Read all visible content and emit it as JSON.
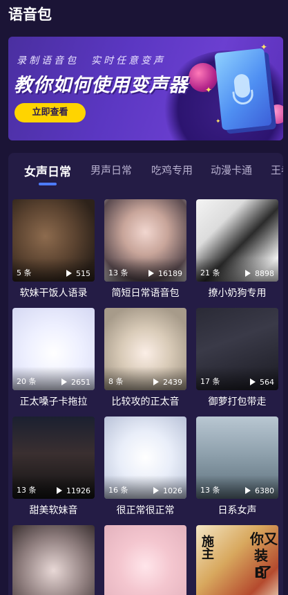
{
  "header": {
    "title": "语音包"
  },
  "banner": {
    "subtitle_left": "录制语音包",
    "subtitle_right": "实时任意变声",
    "title": "教你如何使用变声器",
    "button_label": "立即查看",
    "accent_color": "#ffd400"
  },
  "tabs": [
    {
      "label": "女声日常",
      "active": true
    },
    {
      "label": "男声日常",
      "active": false
    },
    {
      "label": "吃鸡专用",
      "active": false
    },
    {
      "label": "动漫卡通",
      "active": false
    },
    {
      "label": "王者",
      "active": false
    }
  ],
  "packs": [
    {
      "name": "软妹干饭人语录",
      "count": "5 条",
      "plays": "515"
    },
    {
      "name": "简短日常语音包",
      "count": "13 条",
      "plays": "16189"
    },
    {
      "name": "撩小奶狗专用",
      "count": "21 条",
      "plays": "8898"
    },
    {
      "name": "正太嗓子卡拖拉",
      "count": "20 条",
      "plays": "2651"
    },
    {
      "name": "比较攻的正太音",
      "count": "8 条",
      "plays": "2439"
    },
    {
      "name": "御萝打包带走",
      "count": "17 条",
      "plays": "564"
    },
    {
      "name": "甜美软妹音",
      "count": "13 条",
      "plays": "11926"
    },
    {
      "name": "很正常很正常",
      "count": "16 条",
      "plays": "1026"
    },
    {
      "name": "日系女声",
      "count": "13 条",
      "plays": "6380"
    },
    {
      "name": "",
      "count": "",
      "plays": ""
    },
    {
      "name": "",
      "count": "",
      "plays": ""
    },
    {
      "name": "",
      "count": "",
      "plays": ""
    }
  ],
  "sticker": {
    "line1": "你又",
    "line2": "装B",
    "line3": "了",
    "left": "施主"
  },
  "icons": {
    "play": "play-icon"
  }
}
